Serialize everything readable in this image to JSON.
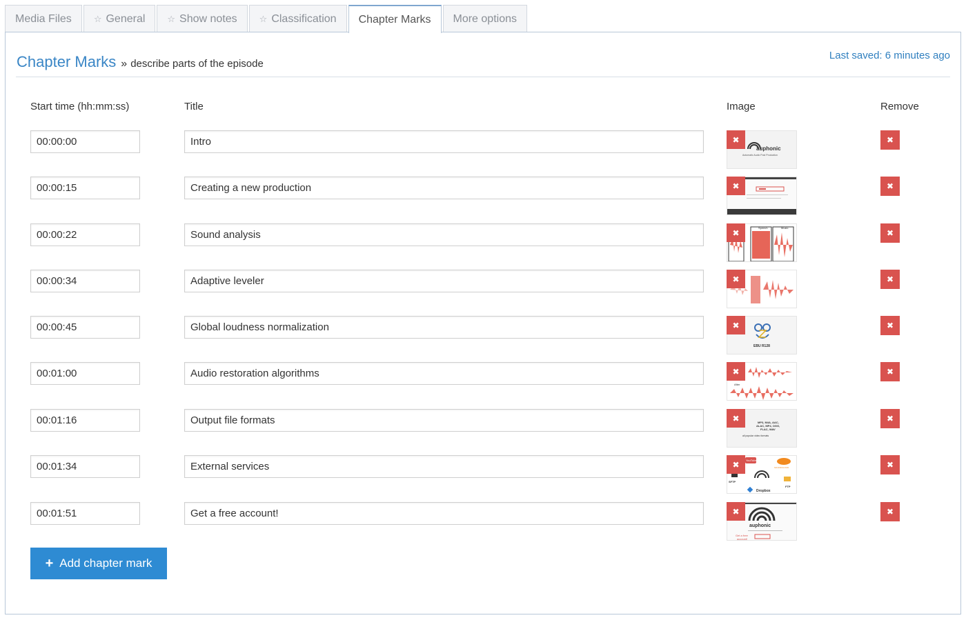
{
  "tabs": [
    {
      "label": "Media Files",
      "starred": false,
      "active": false
    },
    {
      "label": "General",
      "starred": true,
      "active": false
    },
    {
      "label": "Show notes",
      "starred": true,
      "active": false
    },
    {
      "label": "Classification",
      "starred": true,
      "active": false
    },
    {
      "label": "Chapter Marks",
      "starred": false,
      "active": true
    },
    {
      "label": "More options",
      "starred": false,
      "active": false
    }
  ],
  "heading": {
    "title": "Chapter Marks",
    "separator": "»",
    "subtitle": "describe parts of the episode"
  },
  "last_saved": "Last saved: 6 minutes ago",
  "columns": {
    "start_time": "Start time (hh:mm:ss)",
    "title": "Title",
    "image": "Image",
    "remove": "Remove"
  },
  "chapters": [
    {
      "time": "00:00:00",
      "title": "Intro",
      "image": "auphonic-logo-slide"
    },
    {
      "time": "00:00:15",
      "title": "Creating a new production",
      "image": "production-form-screenshot"
    },
    {
      "time": "00:00:22",
      "title": "Sound analysis",
      "image": "speech-music-waveform"
    },
    {
      "time": "00:00:34",
      "title": "Adaptive leveler",
      "image": "leveler-waveform"
    },
    {
      "time": "00:00:45",
      "title": "Global loudness normalization",
      "image": "ebu-r128-logo"
    },
    {
      "time": "00:01:00",
      "title": "Audio restoration algorithms",
      "image": "before-after-waveform"
    },
    {
      "time": "00:01:16",
      "title": "Output file formats",
      "image": "file-formats-slide"
    },
    {
      "time": "00:01:34",
      "title": "External services",
      "image": "external-services-logos"
    },
    {
      "time": "00:01:51",
      "title": "Get a free account!",
      "image": "free-account-slide"
    }
  ],
  "thumb_text": {
    "auphonic": "auphonic",
    "tagline": "Automatic Audio Post Production",
    "speech": "Speech",
    "music": "Music",
    "ebu": "EBU R128",
    "after": "After",
    "formats1": "MP3, M4A, AAC,",
    "formats2": "ALAC, MP4, OGG,",
    "formats3": "FLAC, WAV",
    "formats4": "all popular video formats",
    "youtube": "YouTube",
    "soundcloud": "SOUNDCLOUD",
    "sftp": "SFTP",
    "ftp": "FTP",
    "dropbox": "Dropbox",
    "getfree1": "Get a free",
    "getfree2": "account!"
  },
  "remove_glyph": "✖",
  "add_button": {
    "plus": "+",
    "label": "Add chapter mark"
  },
  "colors": {
    "accent": "#2e8bd3",
    "remove": "#d9534f",
    "link": "#3a86c6"
  }
}
